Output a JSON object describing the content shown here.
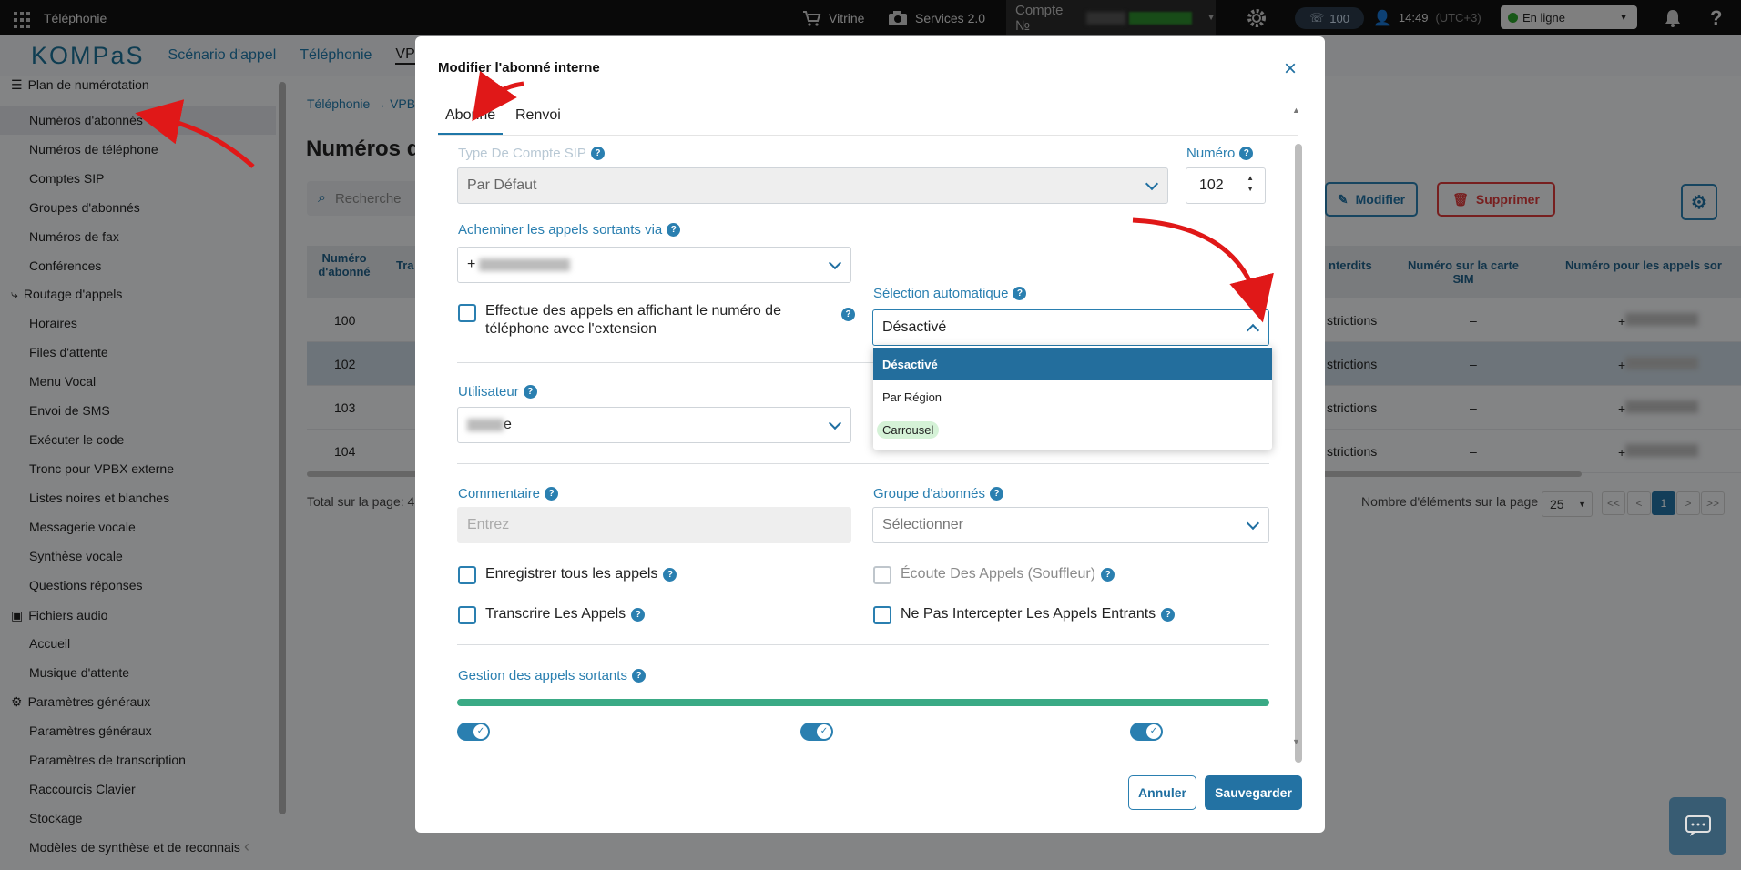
{
  "topbar": {
    "app_title": "Téléphonie",
    "vitrine": "Vitrine",
    "services": "Services 2.0",
    "account_prefix": "Compte №",
    "calls_count": "100",
    "time": "14:49",
    "timezone": "(UTC+3)",
    "status": "En ligne"
  },
  "navbar": {
    "logo": "KOMPaS",
    "links": [
      "Scénario d'appel",
      "Téléphonie",
      "VPBX"
    ]
  },
  "sidebar": {
    "section_numbering": "Plan de numérotation",
    "items_numbering": [
      "Numéros d'abonnés",
      "Numéros de téléphone",
      "Comptes SIP",
      "Groupes d'abonnés",
      "Numéros de fax",
      "Conférences"
    ],
    "section_routing": "Routage d'appels",
    "items_routing": [
      "Horaires",
      "Files d'attente",
      "Menu Vocal",
      "Envoi de SMS",
      "Exécuter le code",
      "Tronc pour VPBX externe",
      "Listes noires et blanches",
      "Messagerie vocale",
      "Synthèse vocale",
      "Questions réponses"
    ],
    "section_audio": "Fichiers audio",
    "items_audio": [
      "Accueil",
      "Musique d'attente"
    ],
    "section_params": "Paramètres généraux",
    "items_params": [
      "Paramètres généraux",
      "Paramètres de transcription",
      "Raccourcis Clavier",
      "Stockage",
      "Modèles de synthèse et de reconnais"
    ]
  },
  "background": {
    "breadcrumb_1": "Téléphonie",
    "breadcrumb_2": "VPBX",
    "title": "Numéros d'",
    "search_placeholder": "Recherche",
    "btn_modify": "Modifier",
    "btn_delete": "Supprimer",
    "col_number": "Numéro d'abonné",
    "col_tr": "Tra",
    "col_forbidden": "nterdits",
    "col_sim": "Numéro sur la carte SIM",
    "col_outgoing": "Numéro pour les appels sor",
    "rows": [
      {
        "num": "100",
        "restr": "strictions",
        "sim": "–",
        "out": "+"
      },
      {
        "num": "102",
        "restr": "strictions",
        "sim": "–",
        "out": "+"
      },
      {
        "num": "103",
        "restr": "strictions",
        "sim": "–",
        "out": "+"
      },
      {
        "num": "104",
        "restr": "strictions",
        "sim": "–",
        "out": "+"
      }
    ],
    "total": "Total sur la page: 4",
    "per_page_label": "Nombre d'éléments sur la page",
    "per_page": "25",
    "pager": [
      "<<",
      "<",
      "1",
      ">",
      ">>"
    ]
  },
  "modal": {
    "title": "Modifier l'abonné interne",
    "close": "×",
    "tabs": [
      "Abonné",
      "Renvoi"
    ],
    "sip_type_label": "Type De Compte SIP",
    "sip_type_value": "Par Défaut",
    "number_label": "Numéro",
    "number_value": "102",
    "route_label": "Acheminer les appels sortants via",
    "route_value": "+",
    "ext_checkbox": "Effectue des appels en affichant le numéro de téléphone avec l'extension",
    "auto_label": "Sélection automatique",
    "auto_value": "Désactivé",
    "auto_options": [
      "Désactivé",
      "Par Région",
      "Carrousel"
    ],
    "user_label": "Utilisateur",
    "user_value": "e",
    "comment_label": "Commentaire",
    "comment_placeholder": "Entrez",
    "group_label": "Groupe d'abonnés",
    "group_placeholder": "Sélectionner",
    "record_all": "Enregistrer tous les appels",
    "listen": "Écoute Des Appels (Souffleur)",
    "transcribe": "Transcrire Les Appels",
    "no_intercept": "Ne Pas Intercepter Les Appels Entrants",
    "outgoing_mgmt": "Gestion des appels sortants",
    "btn_cancel": "Annuler",
    "btn_save": "Sauvegarder"
  },
  "colors": {
    "accent": "#2a7fb0",
    "save": "#2372a3",
    "progress": "#3aaa85",
    "annotation_arrow": "#e01818"
  }
}
